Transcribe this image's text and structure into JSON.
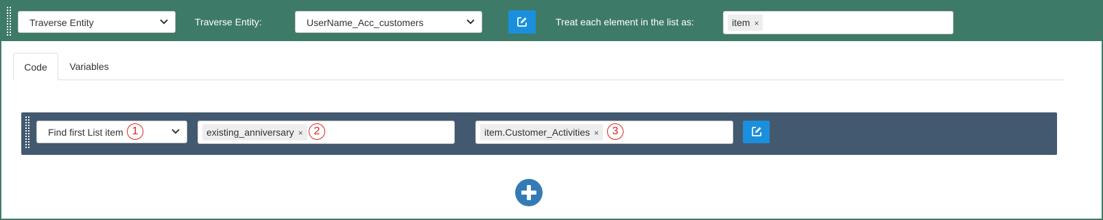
{
  "header": {
    "mode_select": {
      "value": "Traverse Entity"
    },
    "traverse_label": "Traverse Entity:",
    "entity_select": {
      "value": "UserName_Acc_customers"
    },
    "treat_label": "Treat each element in the list as:",
    "alias_tags": [
      {
        "text": "item",
        "remove": "×"
      }
    ]
  },
  "tabs": [
    {
      "label": "Code",
      "active": true
    },
    {
      "label": "Variables",
      "active": false
    }
  ],
  "code_row": {
    "operation_select": {
      "value": "Find first List item"
    },
    "result_tags": [
      {
        "text": "existing_anniversary",
        "remove": "×"
      }
    ],
    "source_tags": [
      {
        "text": "item.Customer_Activities",
        "remove": "×"
      }
    ]
  },
  "annotations": [
    "1",
    "2",
    "3"
  ],
  "icons": {
    "edit": "edit-icon",
    "chevron": "chevron-down-icon",
    "add": "plus-icon",
    "drag": "drag-handle-icon"
  },
  "colors": {
    "header_bg": "#3e7a68",
    "panel_bg": "#435970",
    "button_blue": "#1a90dc",
    "add_button": "#337ab7",
    "annotation_red": "#e02020"
  }
}
